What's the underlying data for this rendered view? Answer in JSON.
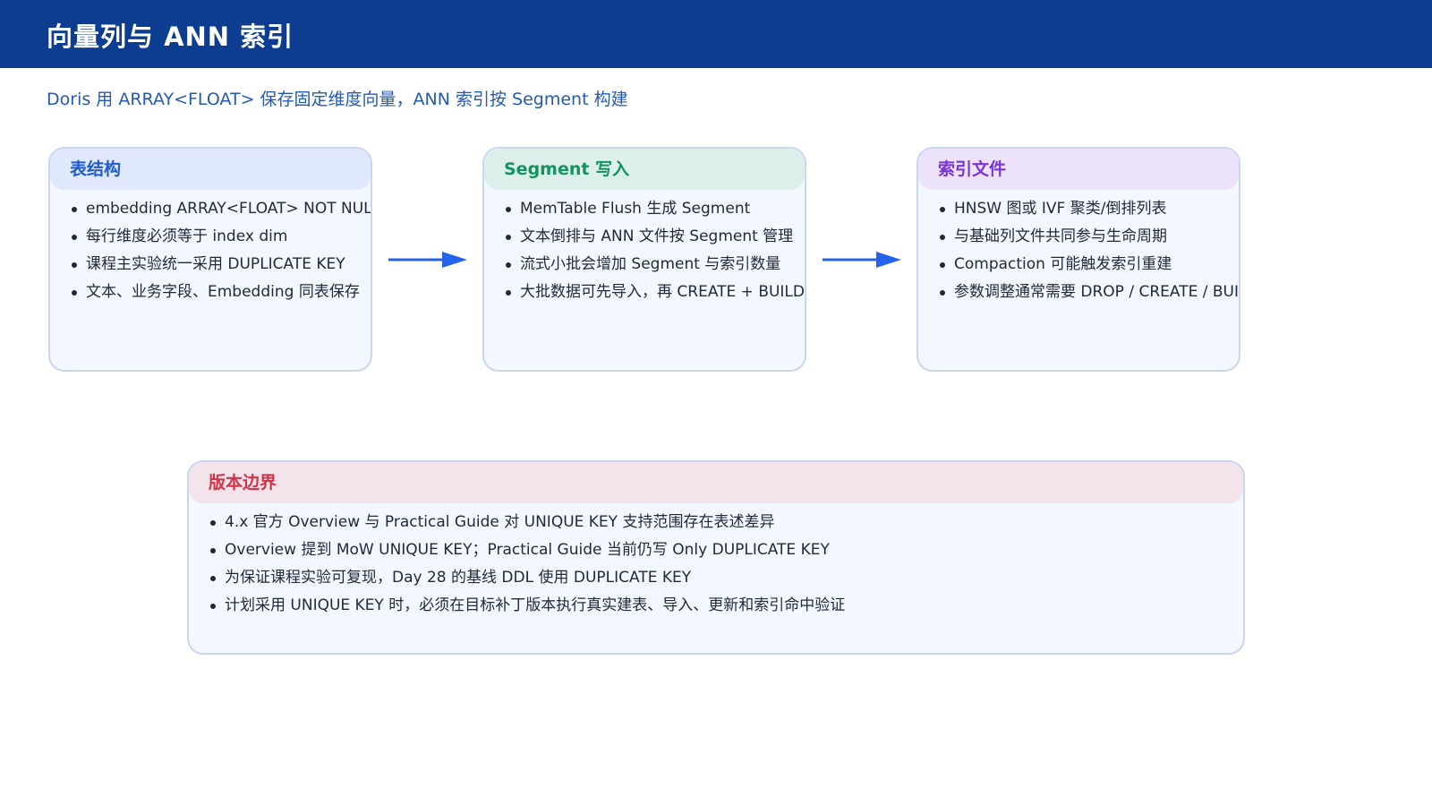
{
  "header": {
    "title": "向量列与 ANN 索引"
  },
  "subtitle": "Doris 用 ARRAY<FLOAT> 保存固定维度向量，ANN 索引按 Segment 构建",
  "colors": {
    "header_bg": "#0d3d91",
    "arrow": "#2563eb",
    "schema_title": "#1f5bd0",
    "segment_title": "#15935f",
    "index_title": "#7a34d6",
    "version_title": "#d0344a"
  },
  "cards": {
    "schema": {
      "title": "表结构",
      "items": [
        "embedding ARRAY<FLOAT> NOT NULL",
        "每行维度必须等于 index dim",
        "课程主实验统一采用 DUPLICATE KEY",
        "文本、业务字段、Embedding 同表保存"
      ]
    },
    "segment": {
      "title": "Segment 写入",
      "items": [
        "MemTable Flush 生成 Segment",
        "文本倒排与 ANN 文件按 Segment 管理",
        "流式小批会增加 Segment 与索引数量",
        "大批数据可先导入，再 CREATE + BUILD"
      ]
    },
    "index": {
      "title": "索引文件",
      "items": [
        "HNSW 图或 IVF 聚类/倒排列表",
        "与基础列文件共同参与生命周期",
        "Compaction 可能触发索引重建",
        "参数调整通常需要 DROP / CREATE / BUILD"
      ]
    },
    "version": {
      "title": "版本边界",
      "items": [
        "4.x 官方 Overview 与 Practical Guide 对 UNIQUE KEY 支持范围存在表述差异",
        "Overview 提到 MoW UNIQUE KEY；Practical Guide 当前仍写 Only DUPLICATE KEY",
        "为保证课程实验可复现，Day 28 的基线 DDL 使用 DUPLICATE KEY",
        "计划采用 UNIQUE KEY 时，必须在目标补丁版本执行真实建表、导入、更新和索引命中验证"
      ]
    }
  },
  "icons": {
    "arrow_1": "arrow-right-icon",
    "arrow_2": "arrow-right-icon"
  }
}
